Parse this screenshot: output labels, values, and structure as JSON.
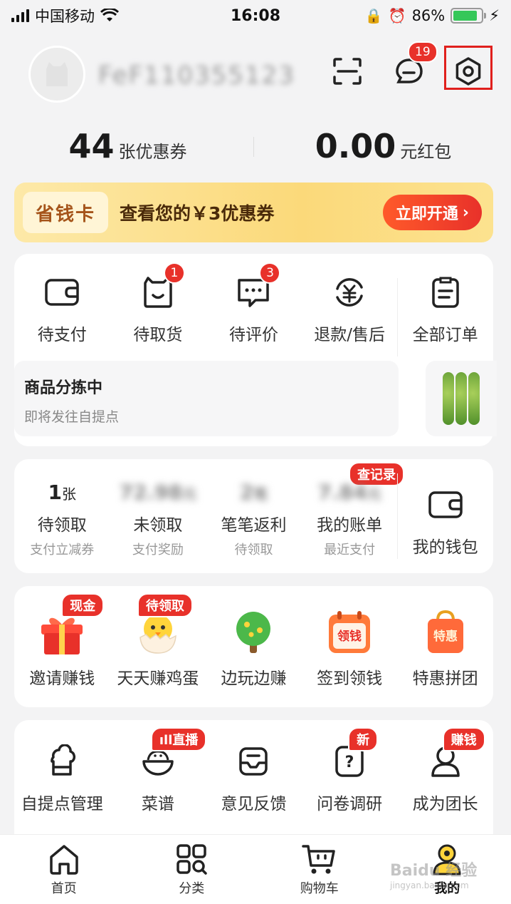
{
  "status_bar": {
    "carrier": "中国移动",
    "time": "16:08",
    "battery": "86%"
  },
  "header": {
    "username": "FeF110355123",
    "message_badge": "19"
  },
  "stats": {
    "coupons_count": "44",
    "coupons_label": "张优惠券",
    "redpacket_amount": "0.00",
    "redpacket_label": "元红包"
  },
  "savings_card": {
    "tag": "省钱卡",
    "text": "查看您的￥3优惠券",
    "button": "立即开通"
  },
  "orders": {
    "items": [
      {
        "label": "待支付",
        "icon": "wallet-icon",
        "badge": ""
      },
      {
        "label": "待取货",
        "icon": "bag-icon",
        "badge": "1"
      },
      {
        "label": "待评价",
        "icon": "comment-icon",
        "badge": "3"
      },
      {
        "label": "退款/售后",
        "icon": "refund-icon",
        "badge": ""
      },
      {
        "label": "全部订单",
        "icon": "clipboard-icon",
        "badge": ""
      }
    ],
    "progress_title": "商品分拣中",
    "progress_sub": "即将发往自提点"
  },
  "wallet": {
    "record_tag": "查记录",
    "items": [
      {
        "value": "1",
        "unit": "张",
        "label": "待领取",
        "sub": "支付立减券"
      },
      {
        "value": "72.98",
        "unit": "元",
        "label": "未领取",
        "sub": "支付奖励"
      },
      {
        "value": "2",
        "unit": "笔",
        "label": "笔笔返利",
        "sub": "待领取"
      },
      {
        "value": "7.84",
        "unit": "元",
        "label": "我的账单",
        "sub": "最近支付"
      }
    ],
    "my_wallet": "我的钱包"
  },
  "activities": [
    {
      "label": "邀请赚钱",
      "tag": "现金",
      "icon": "gift-icon"
    },
    {
      "label": "天天赚鸡蛋",
      "tag": "待领取",
      "icon": "chick-icon"
    },
    {
      "label": "边玩边赚",
      "tag": "",
      "icon": "tree-icon"
    },
    {
      "label": "签到领钱",
      "tag": "",
      "icon": "calendar-icon",
      "icon_text": "领钱"
    },
    {
      "label": "特惠拼团",
      "tag": "",
      "icon": "shopping-bag-icon",
      "icon_text": "特惠"
    }
  ],
  "tools": [
    {
      "label": "自提点管理",
      "tag": "",
      "icon": "store-icon"
    },
    {
      "label": "菜谱",
      "tag": "直播",
      "icon": "bowl-icon"
    },
    {
      "label": "意见反馈",
      "tag": "",
      "icon": "feedback-icon"
    },
    {
      "label": "问卷调研",
      "tag": "新",
      "icon": "question-icon"
    },
    {
      "label": "成为团长",
      "tag": "赚钱",
      "icon": "person-icon"
    }
  ],
  "tabbar": [
    {
      "label": "首页",
      "icon": "home-icon"
    },
    {
      "label": "分类",
      "icon": "grid-icon"
    },
    {
      "label": "购物车",
      "icon": "cart-icon"
    },
    {
      "label": "我的",
      "icon": "profile-icon"
    }
  ],
  "colors": {
    "accent": "#e8312a",
    "gold": "#fbd97a",
    "bg": "#f3f3f4"
  }
}
